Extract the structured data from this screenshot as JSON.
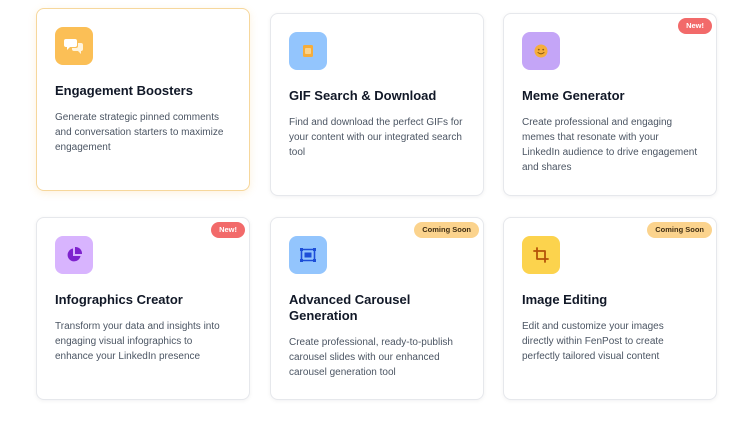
{
  "colors": {
    "engagement_icon_bg": "#fbbf56",
    "gif_icon_bg": "#93c5fd",
    "meme_icon_bg": "#c4a5f7",
    "infographics_icon_bg": "#d8b4fe",
    "carousel_icon_bg": "#93c5fd",
    "image_icon_bg": "#fcd34d",
    "badge_new": "#f26a6a",
    "badge_soon": "#fbd38d"
  },
  "cards": [
    {
      "title": "Engagement Boosters",
      "description": "Generate strategic pinned comments and conversation starters to maximize engagement",
      "icon": "chat-bubbles-icon",
      "badge": ""
    },
    {
      "title": "GIF Search & Download",
      "description": "Find and download the perfect GIFs for your content with our integrated search tool",
      "icon": "gif-image-icon",
      "badge": ""
    },
    {
      "title": "Meme Generator",
      "description": "Create professional and engaging memes that resonate with your LinkedIn audience to drive engagement and shares",
      "icon": "smiley-face-icon",
      "badge": "New!"
    },
    {
      "title": "Infographics Creator",
      "description": "Transform your data and insights into engaging visual infographics to enhance your LinkedIn presence",
      "icon": "pie-chart-icon",
      "badge": "New!"
    },
    {
      "title": "Advanced Carousel Generation",
      "description": "Create professional, ready-to-publish carousel slides with our enhanced carousel generation tool",
      "icon": "carousel-slides-icon",
      "badge": "Coming Soon"
    },
    {
      "title": "Image Editing",
      "description": "Edit and customize your images directly within FenPost to create perfectly tailored visual content",
      "icon": "crop-icon",
      "badge": "Coming Soon"
    }
  ]
}
